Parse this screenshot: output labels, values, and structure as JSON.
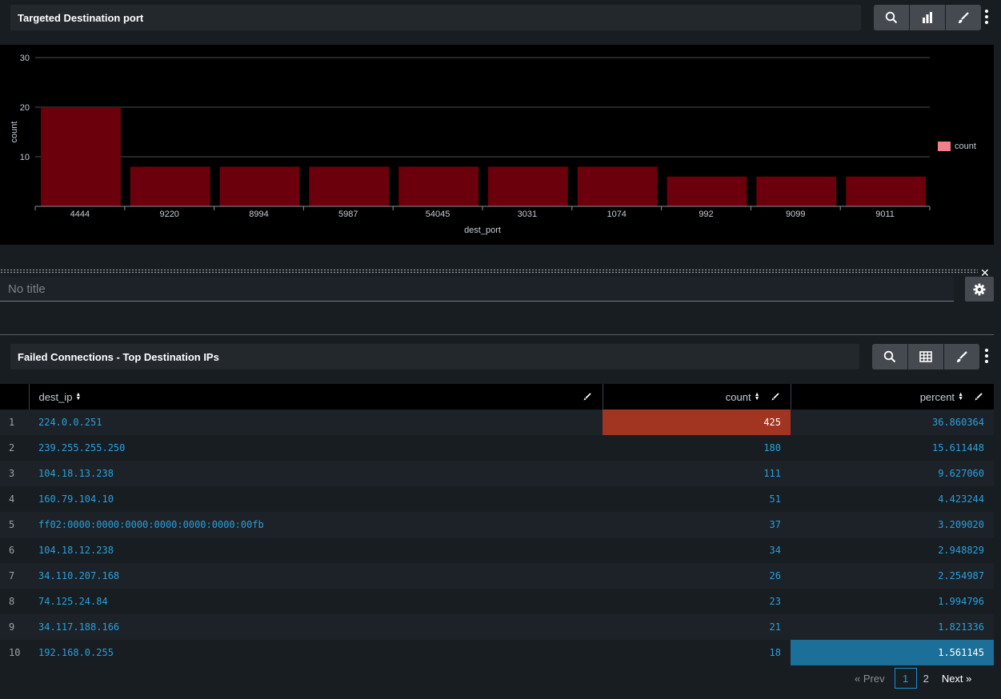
{
  "chart_panel": {
    "title": "Targeted Destination port",
    "buttons": [
      "search-icon",
      "bar-chart-icon",
      "paintbrush-icon"
    ]
  },
  "chart_data": {
    "type": "bar",
    "xlabel": "dest_port",
    "ylabel": "count",
    "categories": [
      "4444",
      "9220",
      "8994",
      "5987",
      "54045",
      "3031",
      "1074",
      "992",
      "9099",
      "9011"
    ],
    "series": [
      {
        "name": "count",
        "values": [
          20,
          8,
          8,
          8,
          8,
          8,
          8,
          6,
          6,
          6
        ]
      }
    ],
    "ylim": [
      0,
      30
    ],
    "yticks": [
      "10",
      "20",
      "30"
    ],
    "grid": true,
    "legend": "right",
    "colors": {
      "bar": "#6b000c",
      "legend_swatch": "#f2808a"
    }
  },
  "empty_panel": {
    "placeholder": "No title",
    "close": "✕"
  },
  "table_panel": {
    "title": "Failed Connections - Top Destination IPs",
    "buttons": [
      "search-icon",
      "table-icon",
      "paintbrush-icon"
    ],
    "columns": [
      "dest_ip",
      "count",
      "percent"
    ],
    "rows": [
      {
        "n": "1",
        "ip": "224.0.0.251",
        "count": "425",
        "percent": "36.860364"
      },
      {
        "n": "2",
        "ip": "239.255.255.250",
        "count": "180",
        "percent": "15.611448"
      },
      {
        "n": "3",
        "ip": "104.18.13.238",
        "count": "111",
        "percent": "9.627060"
      },
      {
        "n": "4",
        "ip": "160.79.104.10",
        "count": "51",
        "percent": "4.423244"
      },
      {
        "n": "5",
        "ip": "ff02:0000:0000:0000:0000:0000:0000:00fb",
        "count": "37",
        "percent": "3.209020"
      },
      {
        "n": "6",
        "ip": "104.18.12.238",
        "count": "34",
        "percent": "2.948829"
      },
      {
        "n": "7",
        "ip": "34.110.207.168",
        "count": "26",
        "percent": "2.254987"
      },
      {
        "n": "8",
        "ip": "74.125.24.84",
        "count": "23",
        "percent": "1.994796"
      },
      {
        "n": "9",
        "ip": "34.117.188.166",
        "count": "21",
        "percent": "1.821336"
      },
      {
        "n": "10",
        "ip": "192.168.0.255",
        "count": "18",
        "percent": "1.561145"
      }
    ],
    "colors": {
      "max_count": "#a23522",
      "min_percent": "#1b6f99",
      "link": "#2ba0dc"
    }
  },
  "pager": {
    "prev": "« Prev",
    "page1": "1",
    "page2": "2",
    "next": "Next »"
  }
}
